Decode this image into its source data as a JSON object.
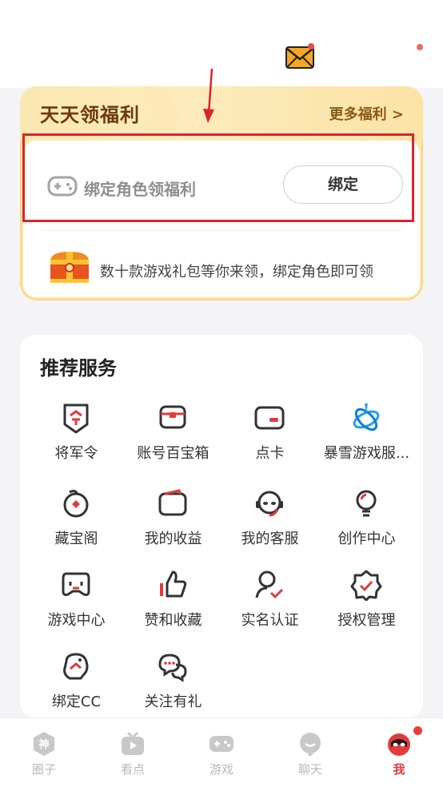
{
  "welfare": {
    "title": "天天领福利",
    "more": "更多福利 >",
    "bind_label": "绑定角色领福利",
    "bind_button": "绑定",
    "gift_text": "数十款游戏礼包等你来领，绑定角色即可领"
  },
  "services": {
    "title": "推荐服务",
    "items": [
      {
        "label": "将军令",
        "icon": "shield-token-icon"
      },
      {
        "label": "账号百宝箱",
        "icon": "treasure-box-icon"
      },
      {
        "label": "点卡",
        "icon": "card-icon"
      },
      {
        "label": "暴雪游戏服...",
        "icon": "blizzard-icon"
      },
      {
        "label": "藏宝阁",
        "icon": "mascot-icon"
      },
      {
        "label": "我的收益",
        "icon": "wallet-icon"
      },
      {
        "label": "我的客服",
        "icon": "customer-service-icon"
      },
      {
        "label": "创作中心",
        "icon": "lightbulb-icon"
      },
      {
        "label": "游戏中心",
        "icon": "game-controller-icon"
      },
      {
        "label": "赞和收藏",
        "icon": "thumbs-up-icon"
      },
      {
        "label": "实名认证",
        "icon": "verified-user-icon"
      },
      {
        "label": "授权管理",
        "icon": "badge-check-icon"
      },
      {
        "label": "绑定CC",
        "icon": "cc-bind-icon"
      },
      {
        "label": "关注有礼",
        "icon": "chat-bubbles-icon"
      }
    ]
  },
  "nav": {
    "items": [
      {
        "label": "圈子",
        "icon": "circle-god-icon"
      },
      {
        "label": "看点",
        "icon": "video-icon"
      },
      {
        "label": "游戏",
        "icon": "gamepad-icon"
      },
      {
        "label": "聊天",
        "icon": "chat-icon"
      },
      {
        "label": "我",
        "icon": "profile-mascot-icon"
      }
    ],
    "active": "我"
  },
  "colors": {
    "accent": "#e33a3a",
    "welfare_bg": "#fde7a8",
    "welfare_title": "#6b3a0c",
    "highlight": "#d9242c"
  }
}
